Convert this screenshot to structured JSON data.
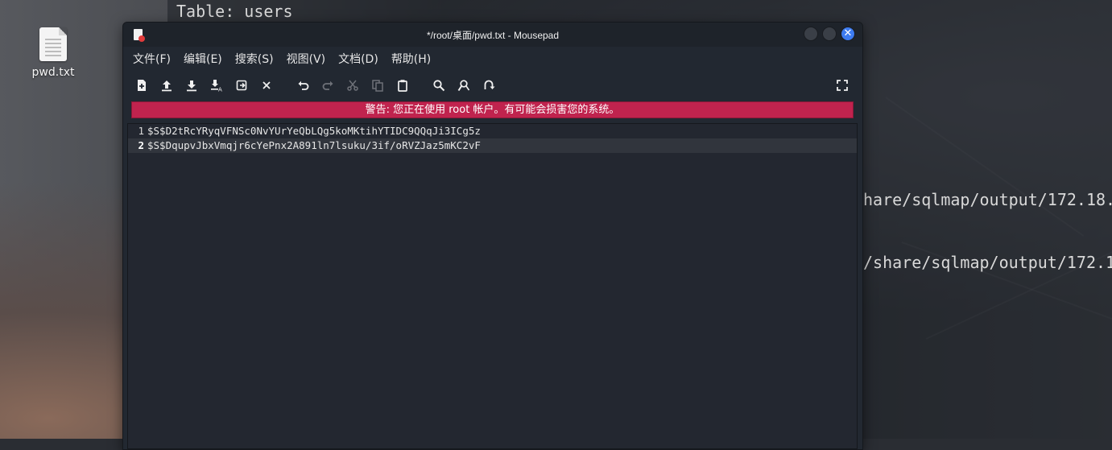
{
  "desktop": {
    "icon_label": "pwd.txt"
  },
  "terminal": {
    "lines": [
      "Table: users",
      "hare/sqlmap/output/172.18.",
      "/share/sqlmap/output/172.1"
    ]
  },
  "window": {
    "title": "*/root/桌面/pwd.txt - Mousepad",
    "close_glyph": "✕"
  },
  "menu": [
    "文件(F)",
    "编辑(E)",
    "搜索(S)",
    "视图(V)",
    "文档(D)",
    "帮助(H)"
  ],
  "toolbar": {
    "buttons": [
      {
        "name": "new-document-icon",
        "enabled": true
      },
      {
        "name": "open-file-icon",
        "enabled": true
      },
      {
        "name": "save-icon",
        "enabled": true
      },
      {
        "name": "save-as-icon",
        "enabled": true
      },
      {
        "name": "reload-icon",
        "enabled": true
      },
      {
        "name": "close-tab-icon",
        "enabled": true
      },
      {
        "name": "undo-icon",
        "enabled": true
      },
      {
        "name": "redo-icon",
        "enabled": false
      },
      {
        "name": "cut-icon",
        "enabled": false
      },
      {
        "name": "copy-icon",
        "enabled": false
      },
      {
        "name": "paste-icon",
        "enabled": true
      },
      {
        "name": "find-icon",
        "enabled": true
      },
      {
        "name": "find-replace-icon",
        "enabled": true
      },
      {
        "name": "goto-icon",
        "enabled": true
      },
      {
        "name": "fullscreen-icon",
        "enabled": true
      }
    ]
  },
  "warning": "警告: 您正在使用 root 帐户。有可能会损害您的系统。",
  "editor": {
    "lines": [
      {
        "number": "1",
        "text": "$S$D2tRcYRyqVFNSc0NvYUrYeQbLQg5koMKtihYTIDC9QQqJi3ICg5z"
      },
      {
        "number": "2",
        "text": "$S$DqupvJbxVmqjr6cYePnx2A891ln7lsuku/3if/oRVZJaz5mKC2vF"
      }
    ],
    "current_line": 2
  },
  "colors": {
    "warning_bg": "#c0234e",
    "close_button": "#3d7bf0",
    "editor_bg": "#232730"
  }
}
